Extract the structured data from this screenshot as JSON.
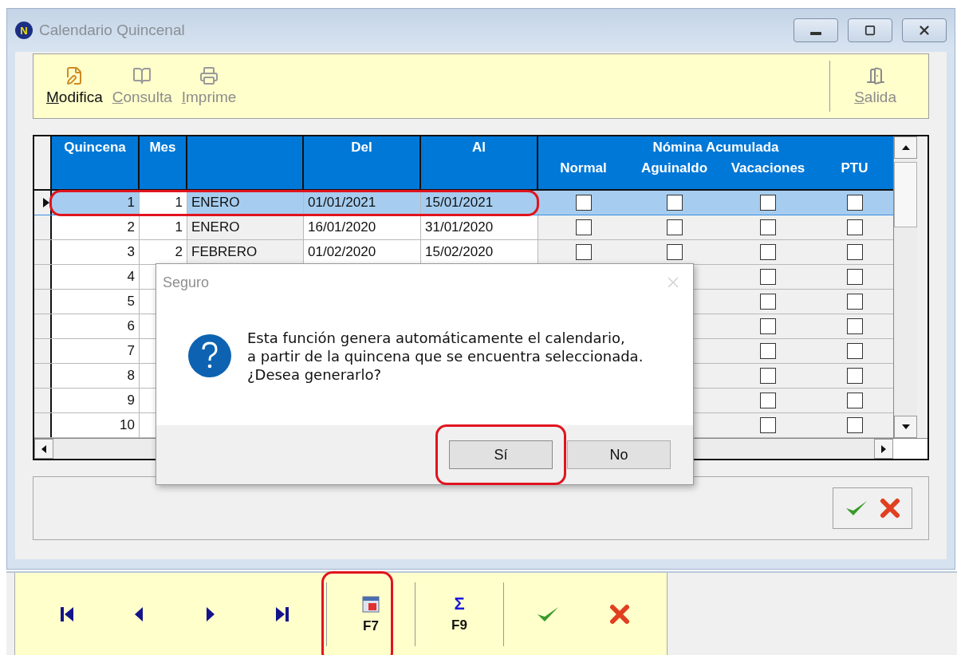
{
  "window": {
    "title": "Calendario Quincenal",
    "app_badge": "N"
  },
  "toolbar": {
    "items": [
      {
        "kind": "edit",
        "label": "Modifica",
        "disabled": false
      },
      {
        "kind": "view",
        "label": "Consulta",
        "disabled": true
      },
      {
        "kind": "print",
        "label": "Imprime",
        "disabled": true
      }
    ],
    "exit": {
      "label": "Salida",
      "disabled": true
    }
  },
  "table": {
    "columns": [
      "Quincena",
      "Mes",
      "Del",
      "Al"
    ],
    "group": {
      "title": "Nómina Acumulada",
      "columns": [
        "Normal",
        "Aguinaldo",
        "Vacaciones",
        "PTU"
      ]
    },
    "rows": [
      {
        "selected": true,
        "quincena": "1",
        "mes": "1",
        "mes_nombre": "ENERO",
        "del": "01/01/2021",
        "al": "15/01/2021",
        "normal": false,
        "aguinaldo": false,
        "vacaciones": false,
        "ptu": false
      },
      {
        "selected": false,
        "quincena": "2",
        "mes": "1",
        "mes_nombre": "ENERO",
        "del": "16/01/2020",
        "al": "31/01/2020",
        "normal": false,
        "aguinaldo": false,
        "vacaciones": false,
        "ptu": false
      },
      {
        "selected": false,
        "quincena": "3",
        "mes": "2",
        "mes_nombre": "FEBRERO",
        "del": "01/02/2020",
        "al": "15/02/2020",
        "normal": false,
        "aguinaldo": false,
        "vacaciones": false,
        "ptu": false
      },
      {
        "selected": false,
        "quincena": "4",
        "vacaciones": false,
        "ptu": false
      },
      {
        "selected": false,
        "quincena": "5",
        "vacaciones": false,
        "ptu": false
      },
      {
        "selected": false,
        "quincena": "6",
        "vacaciones": false,
        "ptu": false
      },
      {
        "selected": false,
        "quincena": "7",
        "vacaciones": false,
        "ptu": false
      },
      {
        "selected": false,
        "quincena": "8",
        "vacaciones": false,
        "ptu": false
      },
      {
        "selected": false,
        "quincena": "9",
        "vacaciones": false,
        "ptu": false
      },
      {
        "selected": false,
        "quincena": "10",
        "vacaciones": false,
        "ptu": false
      }
    ]
  },
  "dialog": {
    "title": "Seguro",
    "message": "Esta función genera automáticamente el calendario,\na partir de la quincena que se encuentra seleccionada.\n¿Desea generarlo?",
    "buttons": [
      {
        "label": "Sí",
        "kind": "yes"
      },
      {
        "label": "No",
        "kind": "no"
      }
    ]
  },
  "bottom_bar": {
    "items": [
      {
        "kind": "first"
      },
      {
        "kind": "prev"
      },
      {
        "kind": "next"
      },
      {
        "kind": "last"
      },
      {
        "kind": "sep"
      },
      {
        "kind": "calendar",
        "label": "F7"
      },
      {
        "kind": "sep"
      },
      {
        "kind": "sigma",
        "glyph": "Σ",
        "label": "F9"
      },
      {
        "kind": "sep"
      },
      {
        "kind": "accept"
      },
      {
        "kind": "cancel"
      }
    ]
  },
  "annotations": [
    {
      "kind": "row"
    },
    {
      "kind": "yes-button"
    },
    {
      "kind": "f7"
    }
  ]
}
